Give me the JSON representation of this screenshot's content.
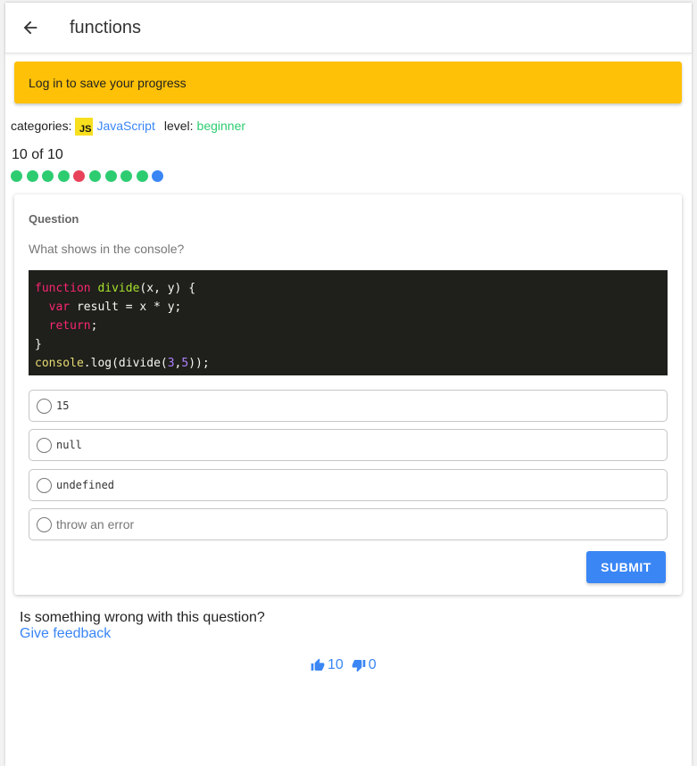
{
  "header": {
    "title": "functions",
    "back_icon": "arrow-left-icon"
  },
  "banner": {
    "text": "Log in to save your progress",
    "color": "#ffc107"
  },
  "meta": {
    "categories_label": "categories:",
    "js_badge": "JS",
    "category": "JavaScript",
    "level_label": "level:",
    "level": "beginner"
  },
  "progress": {
    "text": "10 of 10",
    "dots": [
      "#2ecc71",
      "#2ecc71",
      "#2ecc71",
      "#2ecc71",
      "#e8425a",
      "#2ecc71",
      "#2ecc71",
      "#2ecc71",
      "#2ecc71",
      "#3a86f5"
    ]
  },
  "question": {
    "heading": "Question",
    "prompt": "What shows in the console?",
    "code": {
      "line1": {
        "kw": "function",
        "fn": "divide",
        "rest": "(x, y) {"
      },
      "line2": {
        "indent": "  ",
        "kw": "var",
        "rest": " result = x * y;"
      },
      "line3": {
        "indent": "  ",
        "kw": "return",
        "rest": ";"
      },
      "line4": "}",
      "line5": {
        "obj": "console",
        "a": ".log(divide(",
        "n1": "3",
        "comma": ",",
        "n2": "5",
        "b": "));"
      }
    },
    "options": [
      "15",
      "null",
      "undefined",
      "throw an error"
    ]
  },
  "submit_label": "SUBMIT",
  "feedback": {
    "question_text": "Is something wrong with this question?",
    "link_text": "Give feedback"
  },
  "votes": {
    "up": "10",
    "down": "0",
    "up_icon": "thumbs-up-icon",
    "down_icon": "thumbs-down-icon"
  },
  "colors": {
    "accent": "#3a86f5",
    "success": "#2ecc71",
    "error": "#e8425a",
    "code_bg": "#1f1f1b"
  }
}
